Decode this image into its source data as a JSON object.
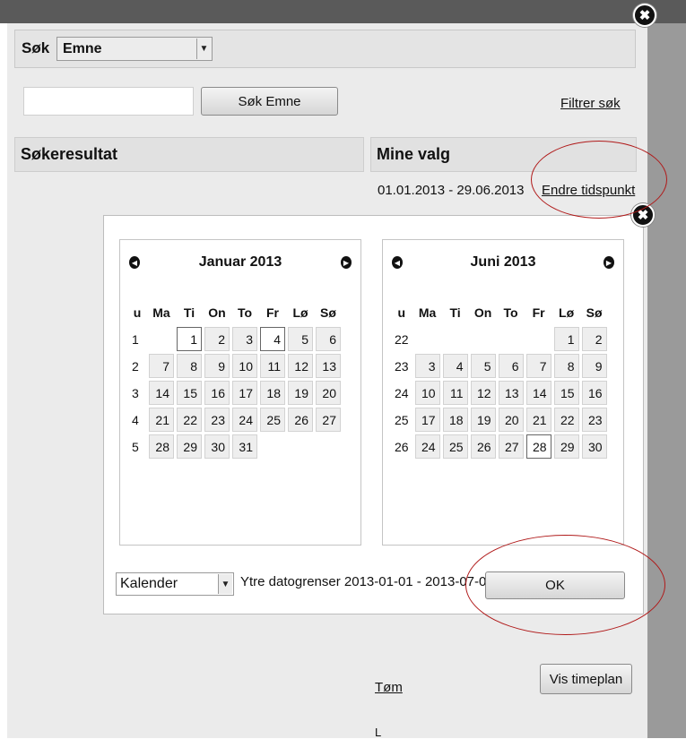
{
  "search": {
    "label": "Søk",
    "type_value": "Emne",
    "input_value": "",
    "button_label": "Søk Emne",
    "filter_link": "Filtrer søk"
  },
  "results": {
    "header": "Søkeresultat"
  },
  "mine_valg": {
    "header": "Mine valg",
    "date_range": "01.01.2013 - 29.06.2013",
    "change_link": "Endre tidspunkt",
    "clear_link": "Tøm",
    "show_schedule_button": "Vis timeplan",
    "bottom_text": "L"
  },
  "close_icon_glyph": "✖",
  "nav_prev_glyph": "◀",
  "nav_next_glyph": "▶",
  "date_picker": {
    "weekday_headers": [
      "u",
      "Ma",
      "Ti",
      "On",
      "To",
      "Fr",
      "Lø",
      "Sø"
    ],
    "calendars": [
      {
        "title": "Januar 2013",
        "weeks": [
          {
            "wk": "1",
            "days": [
              "",
              "1",
              "2",
              "3",
              "4",
              "5",
              "6"
            ]
          },
          {
            "wk": "2",
            "days": [
              "7",
              "8",
              "9",
              "10",
              "11",
              "12",
              "13"
            ]
          },
          {
            "wk": "3",
            "days": [
              "14",
              "15",
              "16",
              "17",
              "18",
              "19",
              "20"
            ]
          },
          {
            "wk": "4",
            "days": [
              "21",
              "22",
              "23",
              "24",
              "25",
              "26",
              "27"
            ]
          },
          {
            "wk": "5",
            "days": [
              "28",
              "29",
              "30",
              "31",
              "",
              "",
              ""
            ]
          }
        ],
        "highlighted": [
          "1",
          "4"
        ]
      },
      {
        "title": "Juni 2013",
        "weeks": [
          {
            "wk": "22",
            "days": [
              "",
              "",
              "",
              "",
              "",
              "1",
              "2"
            ]
          },
          {
            "wk": "23",
            "days": [
              "3",
              "4",
              "5",
              "6",
              "7",
              "8",
              "9"
            ]
          },
          {
            "wk": "24",
            "days": [
              "10",
              "11",
              "12",
              "13",
              "14",
              "15",
              "16"
            ]
          },
          {
            "wk": "25",
            "days": [
              "17",
              "18",
              "19",
              "20",
              "21",
              "22",
              "23"
            ]
          },
          {
            "wk": "26",
            "days": [
              "24",
              "25",
              "26",
              "27",
              "28",
              "29",
              "30"
            ]
          }
        ],
        "highlighted": [
          "28"
        ]
      }
    ],
    "mode_select": "Kalender",
    "bounds_text": "Ytre datogrenser 2013-01-01 - 2013-07-01",
    "ok_label": "OK"
  },
  "colors": {
    "annotation": "#b01a1a",
    "panel": "#ebebeb",
    "topbar": "#5a5a5a"
  }
}
